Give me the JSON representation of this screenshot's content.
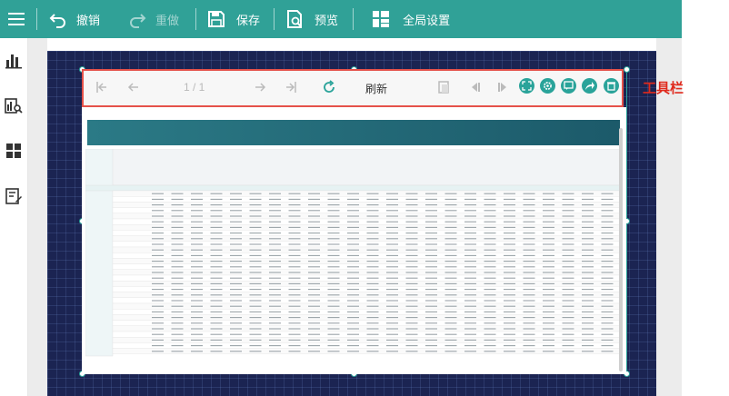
{
  "toolbar_top": {
    "menu_icon": "hamburger-icon",
    "undo_label": "撤销",
    "redo_label": "重做",
    "save_label": "保存",
    "preview_label": "预览",
    "global_settings_label": "全局设置"
  },
  "sidebar": {
    "items": [
      {
        "icon": "bar-chart-icon"
      },
      {
        "icon": "data-search-icon"
      },
      {
        "icon": "grid-components-icon"
      },
      {
        "icon": "form-edit-icon"
      }
    ]
  },
  "report_toolbar": {
    "page_indicator": "1 / 1",
    "refresh_label": "刷新"
  },
  "annotation": {
    "toolbar_label": "工具栏"
  },
  "colors": {
    "accent": "#30a197",
    "canvas": "#1b2452",
    "highlight_border": "#e5524a",
    "annotation_text": "#e02a1d"
  }
}
